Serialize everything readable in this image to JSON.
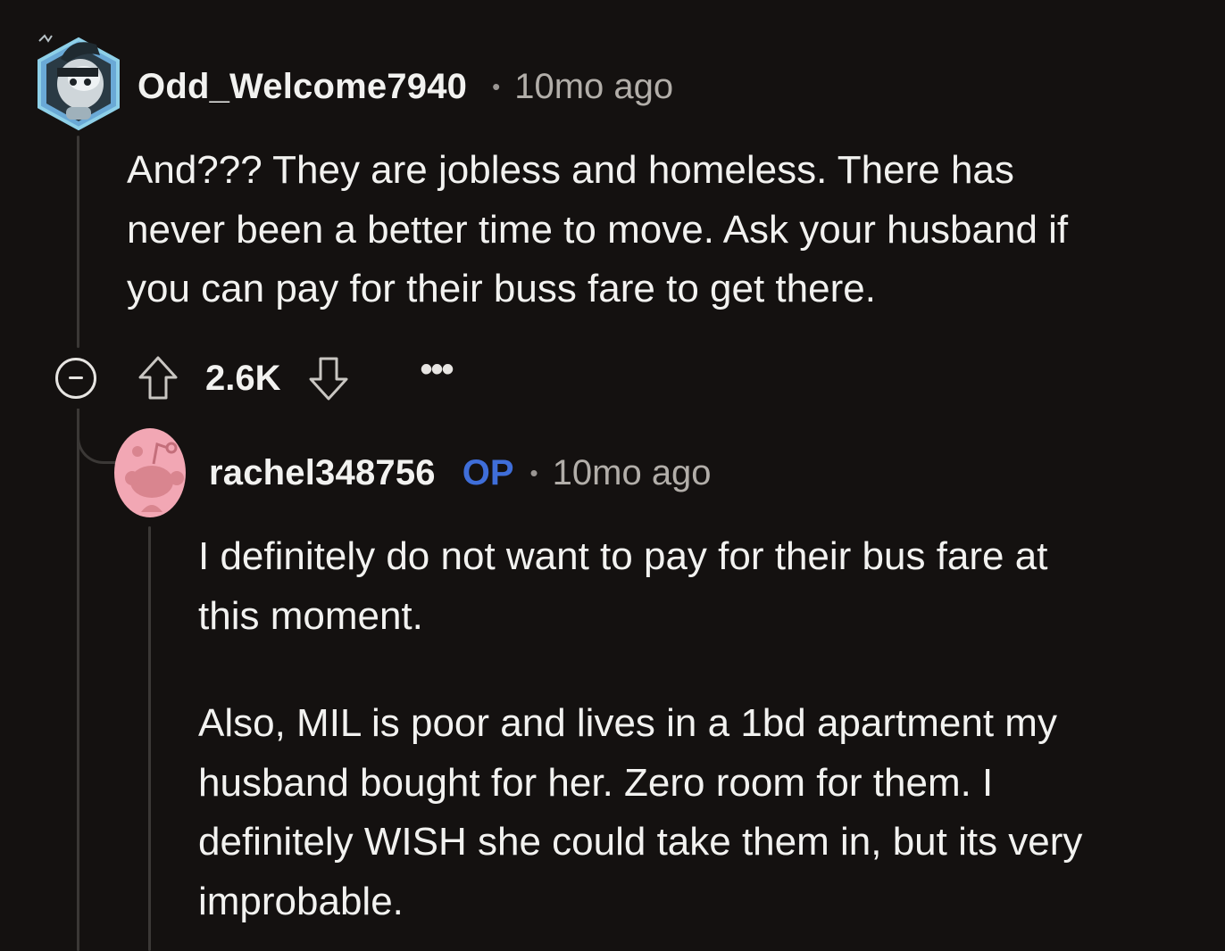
{
  "comment": {
    "username": "Odd_Welcome7940",
    "separator": "•",
    "time": "10mo ago",
    "body_lines": [
      "And??? They are jobless and homeless. There has",
      "never been a better time to move. Ask your husband if",
      "you can pay for their buss fare to get there."
    ],
    "score": "2.6K",
    "more_label": "•••",
    "avatar_icon": "snoo-avatar-icon"
  },
  "reply": {
    "username": "rachel348756",
    "op_badge": "OP",
    "separator": "•",
    "time": "10mo ago",
    "paragraphs": [
      [
        "I definitely do not want to pay for their bus fare at",
        "this moment."
      ],
      [
        "Also, MIL is poor and lives in a 1bd apartment my",
        "husband bought for her. Zero room for them. I",
        "definitely WISH she could take them in, but its very",
        "improbable."
      ]
    ],
    "avatar_icon": "default-snoo-avatar-icon"
  },
  "colors": {
    "background": "#141110",
    "op_badge": "#3f6ed9",
    "meta_text": "#b2aea9",
    "thread_line": "#3b3836"
  }
}
